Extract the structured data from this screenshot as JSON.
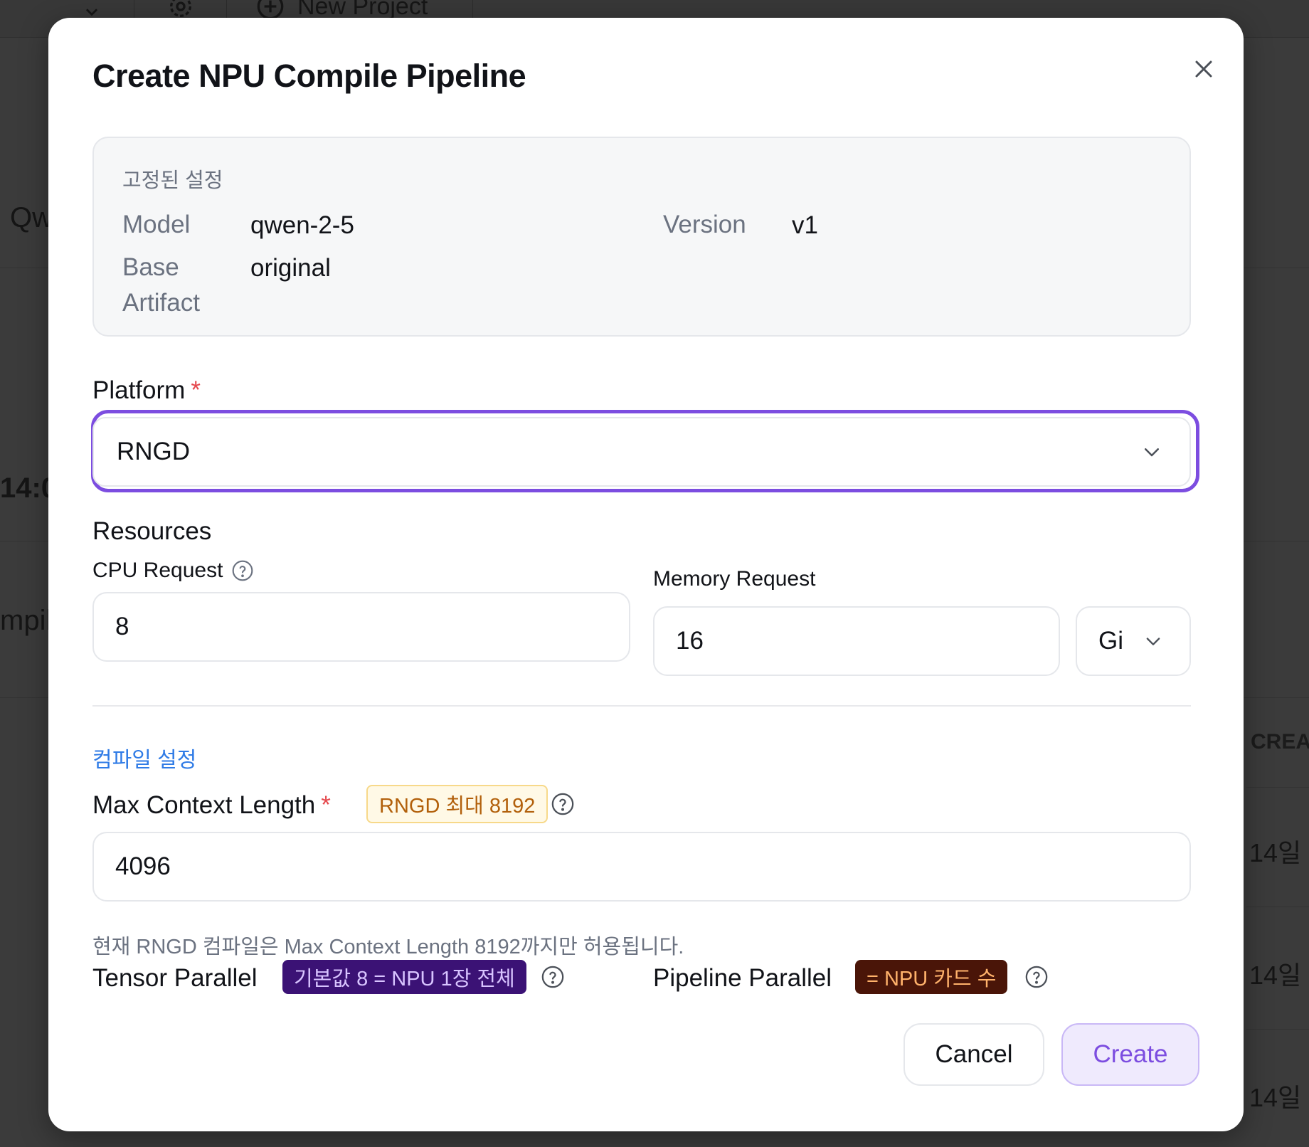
{
  "background": {
    "toolbar": {
      "new_project_label": "New Project"
    },
    "fragments": {
      "row_title": "Qw",
      "row_time": "14:0",
      "row_type": "mpil",
      "right_header": "CREA",
      "right_dates": [
        "14일 ",
        "14일 ",
        "14일 "
      ]
    }
  },
  "modal": {
    "title": "Create NPU Compile Pipeline",
    "close_label": "×",
    "fixed_settings": {
      "title": "고정된 설정",
      "model_label": "Model",
      "model_value": "qwen-2-5",
      "version_label": "Version",
      "version_value": "v1",
      "base_label_line1": "Base",
      "base_label_line2": "Artifact",
      "base_value": "original"
    },
    "platform": {
      "label": "Platform",
      "required_mark": "*",
      "value": "RNGD"
    },
    "resources": {
      "heading": "Resources",
      "cpu_label": "CPU Request",
      "cpu_value": "8",
      "memory_label": "Memory Request",
      "memory_value": "16",
      "memory_unit": "Gi"
    },
    "compile": {
      "heading": "컴파일 설정",
      "max_context_label": "Max Context Length",
      "required_mark": "*",
      "max_context_badge": "RNGD 최대 8192",
      "max_context_value": "4096",
      "hint": "현재 RNGD 컴파일은 Max Context Length 8192까지만 허용됩니다.",
      "tensor_parallel_label": "Tensor Parallel",
      "tensor_parallel_badge": "기본값 8 = NPU 1장 전체",
      "pipeline_parallel_label": "Pipeline Parallel",
      "pipeline_parallel_badge": "= NPU 카드 수"
    },
    "buttons": {
      "cancel": "Cancel",
      "create": "Create"
    }
  },
  "colors": {
    "accent": "#7c4de0",
    "link_blue": "#2f7be6",
    "required_red": "#e5484d"
  },
  "icons": [
    "close-icon",
    "chevron-down-icon",
    "help-icon",
    "settings-icon",
    "plus-circle-icon"
  ]
}
